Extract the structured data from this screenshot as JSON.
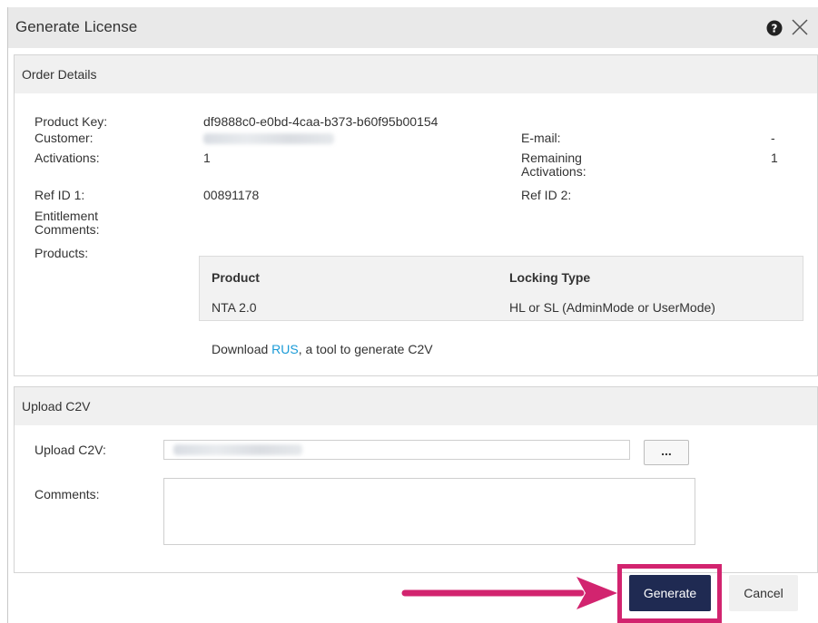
{
  "dialog": {
    "title": "Generate License",
    "help_icon": "question-circle-icon",
    "close_icon": "close-x-icon"
  },
  "order_details": {
    "header": "Order Details",
    "product_key_label": "Product Key:",
    "product_key_value": "df9888c0-e0bd-4caa-b373-b60f95b00154",
    "customer_label": "Customer:",
    "email_label": "E-mail:",
    "email_value": "-",
    "activations_label": "Activations:",
    "activations_value": "1",
    "remaining_label_line1": "Remaining",
    "remaining_label_line2": "Activations:",
    "remaining_value": "1",
    "ref1_label": "Ref ID 1:",
    "ref1_value": "00891178",
    "ref2_label": "Ref ID 2:",
    "entitlement_label_line1": "Entitlement",
    "entitlement_label_line2": "Comments:",
    "products_label": "Products:",
    "products_table": {
      "columns": [
        "Product",
        "Locking Type"
      ],
      "rows": [
        [
          "NTA 2.0",
          "HL or SL (AdminMode or UserMode)"
        ]
      ]
    },
    "download_prefix": "Download ",
    "download_link": "RUS",
    "download_suffix": ", a tool to generate C2V"
  },
  "upload_c2v": {
    "header": "Upload C2V",
    "upload_label": "Upload C2V:",
    "browse_label": "...",
    "comments_label": "Comments:"
  },
  "footer": {
    "generate_label": "Generate",
    "cancel_label": "Cancel"
  },
  "colors": {
    "highlight": "#d2246f",
    "generate_bg": "#1f2a52",
    "link": "#1a9bd7"
  }
}
